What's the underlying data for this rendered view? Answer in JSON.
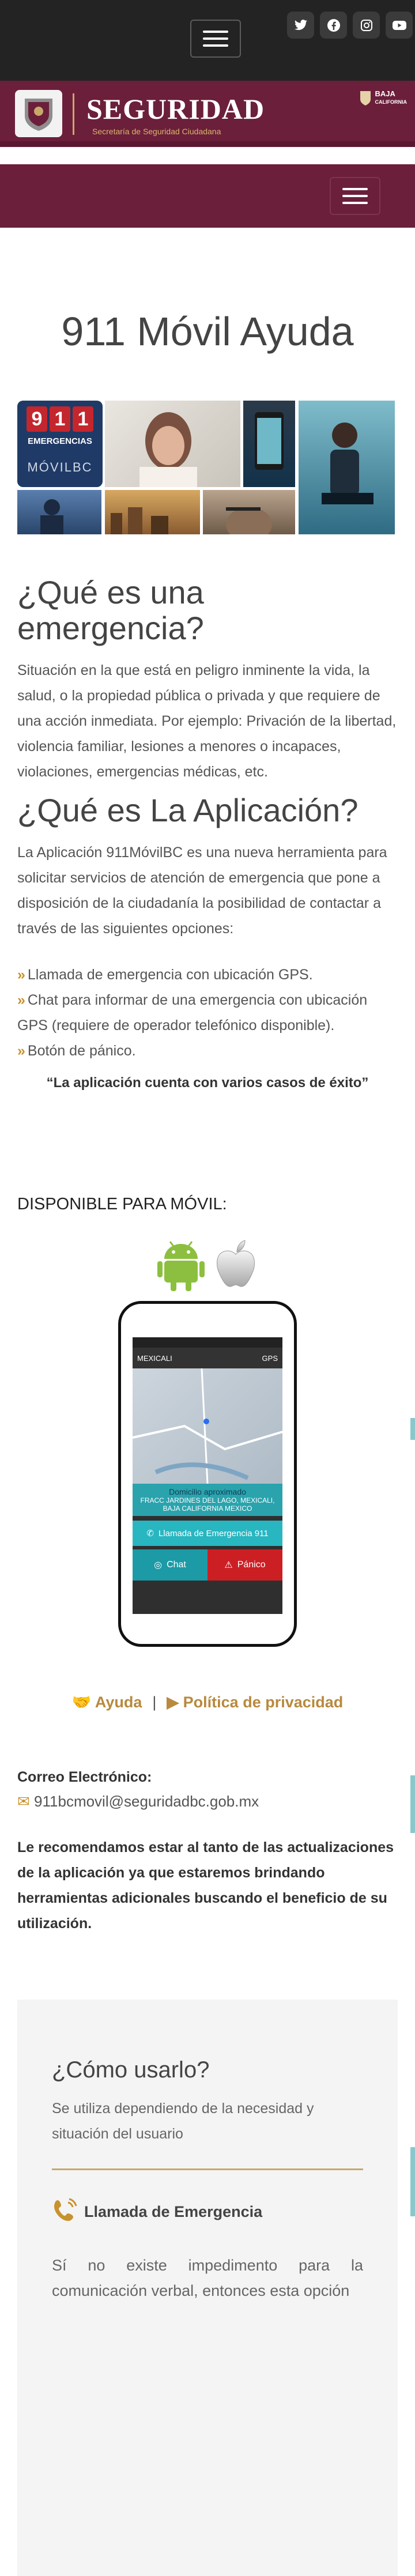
{
  "header": {
    "brand_title": "SEGURIDAD",
    "brand_subtitle": "Secretaría de Seguridad Ciudadana",
    "bc_logo_line1": "BAJA",
    "bc_logo_line2": "CALIFORNIA",
    "social": [
      "twitter-icon",
      "facebook-icon",
      "instagram-icon",
      "youtube-icon"
    ]
  },
  "main": {
    "title": "911 Móvil Ayuda",
    "collage": {
      "tile_911_digits": [
        "9",
        "1",
        "1"
      ],
      "tile_911_label": "EMERGENCIAS",
      "tile_911_brand": "MÓVILBC"
    },
    "q1": "¿Qué es una emergencia?",
    "q1_text": "Situación en la que está en peligro inminente la vida, la salud, o la propiedad pública o privada y que requiere de una acción inmediata. Por ejemplo: Privación de la libertad, violencia familiar, lesiones a menores o incapaces, violaciones, emergencias médicas, etc.",
    "q2": "¿Qué es La Aplicación?",
    "q2_text": "La Aplicación 911MóvilBC es una nueva herramienta para solicitar servicios de atención de emergencia que pone a disposición de la ciudadanía la posibilidad de contactar a través de las siguientes opciones:",
    "options": [
      "Llamada de emergencia con ubicación GPS.",
      "Chat para informar de una emergencia con ubicación GPS (requiere de operador telefónico disponible).",
      "Botón de pánico."
    ],
    "quote": "“La aplicación cuenta con varios casos de éxito”",
    "available": "DISPONIBLE PARA MÓVIL:",
    "phone_screen": {
      "city": "MEXICALI",
      "gps": "GPS",
      "addr_label": "Domicilio aproximado",
      "addr": "FRACC JARDINES DEL LAGO, MEXICALI, BAJA CALIFORNIA MEXICO",
      "call_btn": "Llamada de Emergencia 911",
      "chat_btn": "Chat",
      "panic_btn": "Pánico"
    },
    "links": {
      "help": "Ayuda",
      "separator": "|",
      "privacy": "Política de privacidad"
    },
    "email_label": "Correo Electrónico:",
    "email": "911bcmovil@seguridadbc.gob.mx",
    "recommend": "Le recomendamos estar al tanto de las actualizaciones de la aplicación ya que estaremos brindando herramientas adicionales buscando el beneficio de su utilización.",
    "how": {
      "title": "¿Cómo usarlo?",
      "intro": "Se utiliza dependiendo de la necesidad y situación del usuario",
      "item_title": "Llamada de Emergencia",
      "item_text": "Sí no existe impedimento para la comunicación verbal, entonces esta opción"
    }
  },
  "colors": {
    "maroon": "#6b1f3a",
    "gold": "#c8a86b",
    "link_gold": "#b8893e",
    "dark": "#232323",
    "teal": "#28b6c1",
    "panic_red": "#cc1f24"
  }
}
